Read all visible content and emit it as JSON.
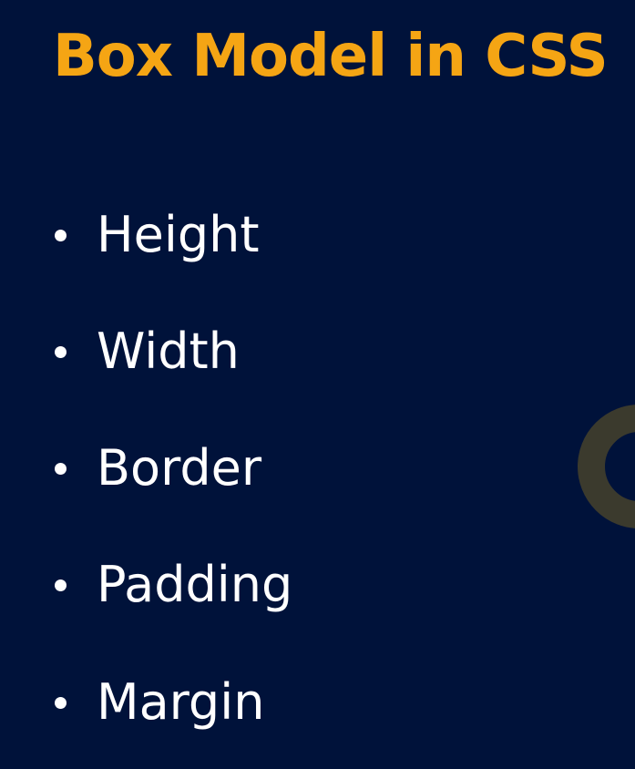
{
  "slide": {
    "title": "Box Model in CSS",
    "items": [
      {
        "label": "Height"
      },
      {
        "label": "Width"
      },
      {
        "label": "Border"
      },
      {
        "label": "Padding"
      },
      {
        "label": "Margin"
      }
    ]
  },
  "colors": {
    "background": "#00123a",
    "title": "#f5a514",
    "text": "#ffffff",
    "decoration": "#3b3a2d"
  }
}
